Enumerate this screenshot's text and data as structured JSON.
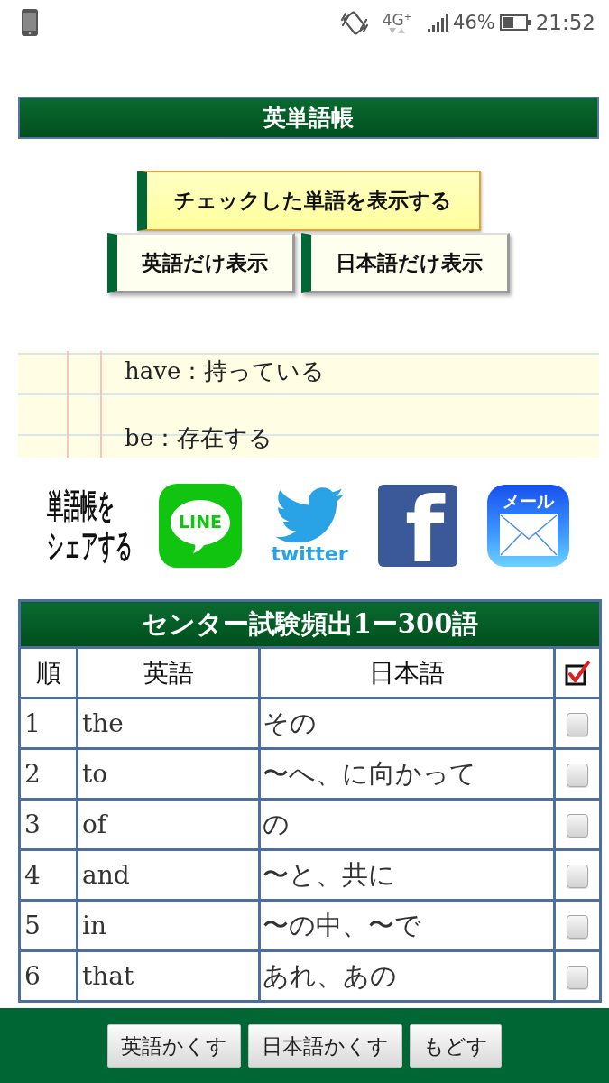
{
  "status_bar": {
    "network": "4G$^{+}$",
    "battery": "46%",
    "time": "21:52"
  },
  "title": "英単語帳",
  "view_buttons": [
    [
      {
        "label": "チェックした単語を表示する",
        "kind": "highlight"
      }
    ],
    [
      {
        "label": "英語だけ表示",
        "kind": "plain"
      },
      {
        "label": "日本語だけ表示",
        "kind": "plain"
      }
    ]
  ],
  "notebook": {
    "entries": [
      "have：持っている",
      "be：存在する"
    ]
  },
  "share": {
    "label_lines": [
      "単語帳を",
      "シェアする"
    ],
    "services": [
      {
        "kind": "line",
        "label": "LINE"
      },
      {
        "kind": "twitter",
        "label": "twitter"
      },
      {
        "kind": "facebook",
        "label": "f"
      },
      {
        "kind": "mail",
        "label": "メール"
      }
    ]
  },
  "word_table": {
    "title": "センター試験頻出1ー300語",
    "columns": [
      "順",
      "英語",
      "日本語"
    ],
    "rows": [
      {
        "rank": "1",
        "english": "the",
        "japanese": "その",
        "checked": false
      },
      {
        "rank": "2",
        "english": "to",
        "japanese": "〜へ、に向かって",
        "checked": false
      },
      {
        "rank": "3",
        "english": "of",
        "japanese": "の",
        "checked": false
      },
      {
        "rank": "4",
        "english": "and",
        "japanese": "〜と、共に",
        "checked": false
      },
      {
        "rank": "5",
        "english": "in",
        "japanese": "〜の中、〜で",
        "checked": false
      },
      {
        "rank": "6",
        "english": "that",
        "japanese": "あれ、あの",
        "checked": false
      }
    ]
  },
  "bottom_bar": {
    "buttons": [
      "英語かくす",
      "日本語かくす",
      "もどす"
    ]
  }
}
